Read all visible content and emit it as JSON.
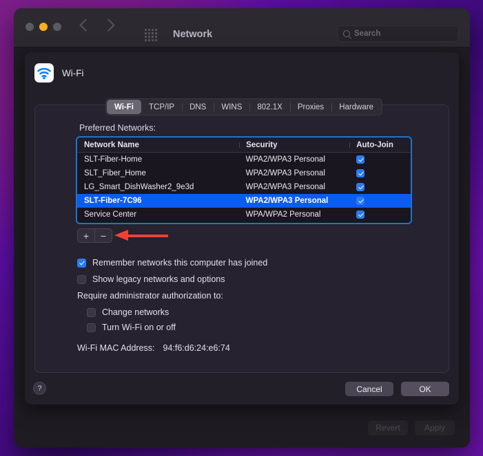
{
  "window": {
    "title": "Network",
    "traffic_lights": [
      "close-button",
      "minimize-button",
      "zoom-button"
    ],
    "nav_back": "back-icon",
    "nav_forward": "forward-icon",
    "grid_icon": "grid-view-icon",
    "search": {
      "placeholder": "Search",
      "value": "",
      "icon": "search-icon"
    },
    "behind_buttons": [
      {
        "label": "Revert",
        "enabled": false
      },
      {
        "label": "Apply",
        "enabled": false
      }
    ]
  },
  "sheet": {
    "service_icon": "wifi-icon",
    "service_name": "Wi-Fi",
    "tabs": [
      {
        "label": "Wi-Fi",
        "selected": true
      },
      {
        "label": "TCP/IP",
        "selected": false
      },
      {
        "label": "DNS",
        "selected": false
      },
      {
        "label": "WINS",
        "selected": false
      },
      {
        "label": "802.1X",
        "selected": false
      },
      {
        "label": "Proxies",
        "selected": false
      },
      {
        "label": "Hardware",
        "selected": false
      }
    ],
    "preferred_networks_label": "Preferred Networks:",
    "table": {
      "columns": [
        "Network Name",
        "Security",
        "Auto-Join"
      ],
      "rows": [
        {
          "name": "SLT-Fiber-Home",
          "security": "WPA2/WPA3 Personal",
          "auto_join": true,
          "selected": false
        },
        {
          "name": "SLT_Fiber_Home",
          "security": "WPA2/WPA3 Personal",
          "auto_join": true,
          "selected": false
        },
        {
          "name": "LG_Smart_DishWasher2_9e3d",
          "security": "WPA2/WPA3 Personal",
          "auto_join": true,
          "selected": false
        },
        {
          "name": "SLT-Fiber-7C96",
          "security": "WPA2/WPA3 Personal",
          "auto_join": true,
          "selected": true
        },
        {
          "name": "Service Center",
          "security": "WPA/WPA2 Personal",
          "auto_join": true,
          "selected": false
        },
        {
          "name": "",
          "security": "",
          "auto_join": true,
          "selected": false
        }
      ]
    },
    "add_button": "+",
    "remove_button": "−",
    "annotation": {
      "type": "arrow",
      "color": "#ef4035",
      "points_to": "remove-network-button"
    },
    "options": [
      {
        "label": "Remember networks this computer has joined",
        "checked": true
      },
      {
        "label": "Show legacy networks and options",
        "checked": false
      }
    ],
    "require_admin_label": "Require administrator authorization to:",
    "admin_options": [
      {
        "label": "Change networks",
        "checked": false
      },
      {
        "label": "Turn Wi-Fi on or off",
        "checked": false
      }
    ],
    "mac": {
      "label": "Wi-Fi MAC Address:",
      "value": "94:f6:d6:24:e6:74"
    },
    "help_button": "?",
    "buttons": [
      {
        "label": "Cancel"
      },
      {
        "label": "OK"
      }
    ]
  },
  "colors": {
    "selection_blue": "#0b5cf0",
    "focus_ring": "#1f74c8",
    "checkbox_blue": "#2a7bf2",
    "annotation_red": "#ef4035",
    "minimize_yellow": "#f6b01e"
  }
}
